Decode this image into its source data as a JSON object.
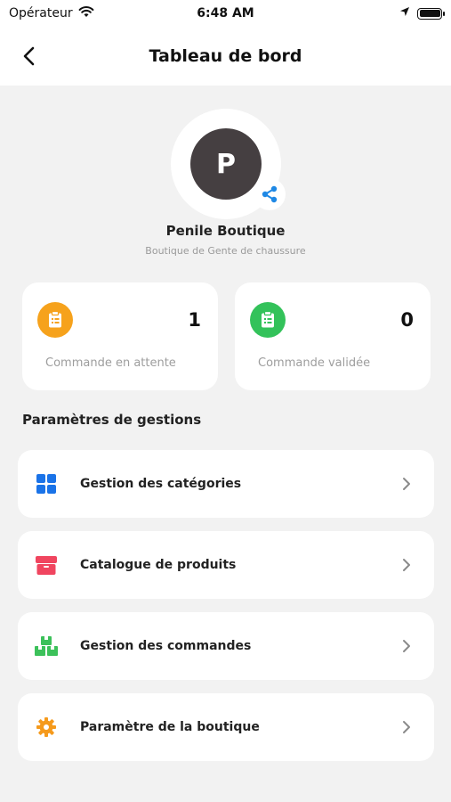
{
  "status_bar": {
    "carrier": "Opérateur",
    "time": "6:48 AM"
  },
  "header": {
    "title": "Tableau de bord"
  },
  "profile": {
    "initial": "P",
    "name": "Penile Boutique",
    "description": "Boutique de Gente de chaussure"
  },
  "stats": {
    "pending": {
      "value": "1",
      "label": "Commande en attente",
      "color": "#f6a21c"
    },
    "validated": {
      "value": "0",
      "label": "Commande validée",
      "color": "#33c25a"
    }
  },
  "section": {
    "title": "Paramètres de gestions"
  },
  "menu": [
    {
      "label": "Gestion des catégories",
      "icon": "grid-icon",
      "color": "#1a73e8"
    },
    {
      "label": "Catalogue de produits",
      "icon": "box-icon",
      "color": "#f0455f"
    },
    {
      "label": "Gestion des commandes",
      "icon": "boxes-icon",
      "color": "#3cc15a"
    },
    {
      "label": "Paramètre de la boutique",
      "icon": "gear-icon",
      "color": "#f59a1c"
    }
  ],
  "colors": {
    "accent_share": "#1e88e5",
    "avatar_bg": "#453f41"
  }
}
